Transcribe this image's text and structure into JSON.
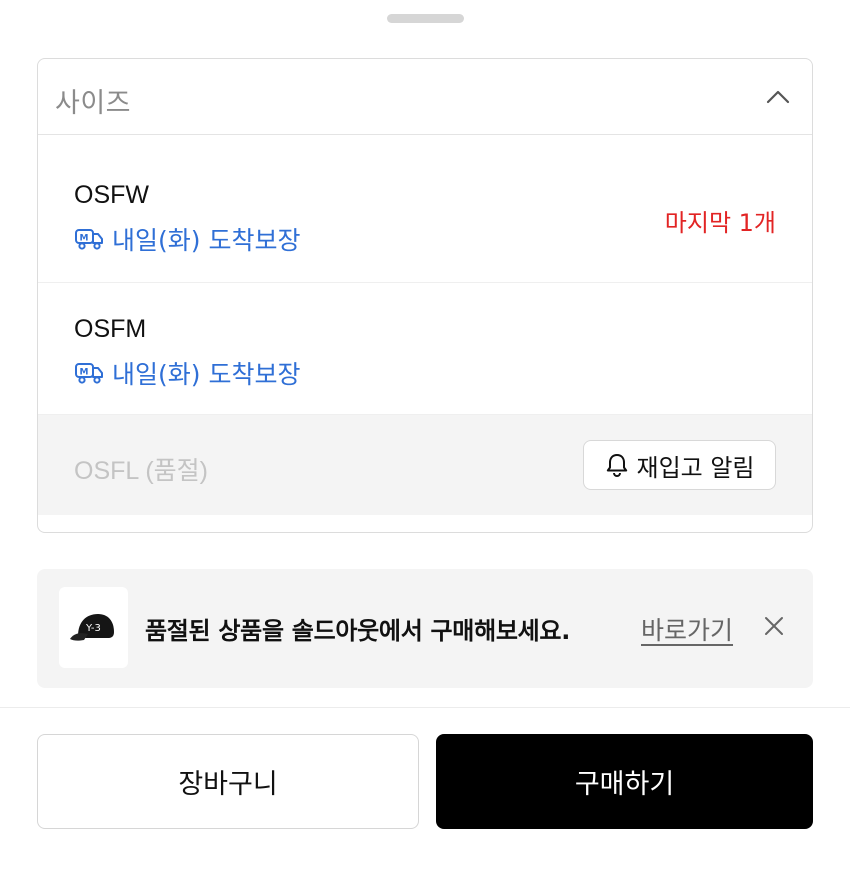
{
  "select": {
    "label": "사이즈",
    "icon": "chevron-up-icon"
  },
  "options": [
    {
      "size": "OSFW",
      "delivery": "내일(화) 도착보장",
      "stock": "마지막 1개"
    },
    {
      "size": "OSFM",
      "delivery": "내일(화) 도착보장"
    }
  ],
  "soldout_option": {
    "size": "OSFL (품절)",
    "restock_label": "재입고 알림"
  },
  "banner": {
    "message": "품절된 상품을 솔드아웃에서 구매해보세요.",
    "link_label": "바로가기"
  },
  "actions": {
    "cart_label": "장바구니",
    "buy_label": "구매하기"
  },
  "colors": {
    "delivery_blue": "#2f6fd6",
    "stock_red": "#e22424",
    "buy_button": "#000000"
  }
}
